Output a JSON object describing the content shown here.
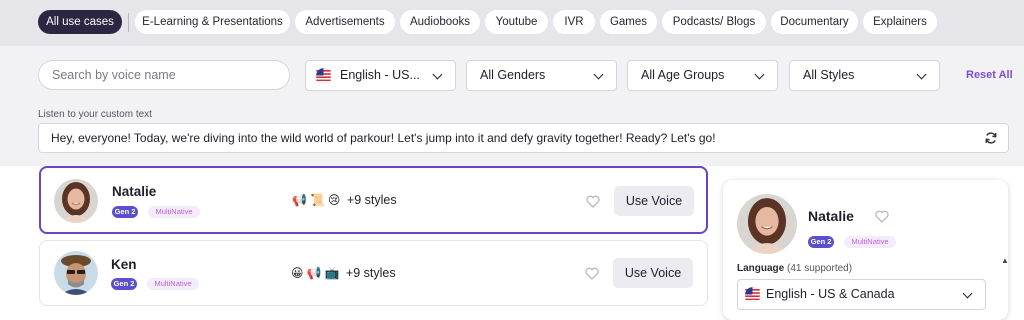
{
  "tabs": [
    {
      "label": "All use cases",
      "active": true
    },
    {
      "label": "E-Learning & Presentations"
    },
    {
      "label": "Advertisements"
    },
    {
      "label": "Audiobooks"
    },
    {
      "label": "Youtube"
    },
    {
      "label": "IVR"
    },
    {
      "label": "Games"
    },
    {
      "label": "Podcasts/ Blogs"
    },
    {
      "label": "Documentary"
    },
    {
      "label": "Explainers"
    }
  ],
  "filters": {
    "search_placeholder": "Search by voice name",
    "language": "English - US...",
    "gender": "All Genders",
    "age": "All Age Groups",
    "style": "All Styles",
    "reset": "Reset All"
  },
  "custom_text": {
    "label": "Listen to your custom text",
    "value": "Hey, everyone! Today, we're diving into the wild world of parkour! Let's jump into it and defy gravity together! Ready? Let's go!"
  },
  "voices": [
    {
      "name": "Natalie",
      "gen": "Gen 2",
      "multi": "MultiNative",
      "emojis": [
        "📢",
        "📜",
        "😢"
      ],
      "styles": "+9 styles",
      "use": "Use Voice"
    },
    {
      "name": "Ken",
      "gen": "Gen 2",
      "multi": "MultiNative",
      "emojis": [
        "😀",
        "📢",
        "📺"
      ],
      "styles": "+9 styles",
      "use": "Use Voice"
    }
  ],
  "detail": {
    "name": "Natalie",
    "gen": "Gen 2",
    "multi": "MultiNative",
    "language_label": "Language",
    "language_count": "(41 supported)",
    "language_value": "English - US & Canada"
  },
  "colors": {
    "accent": "#6a44c8",
    "active_tab": "#2d2642",
    "gen_badge": "#5a4fcf"
  }
}
